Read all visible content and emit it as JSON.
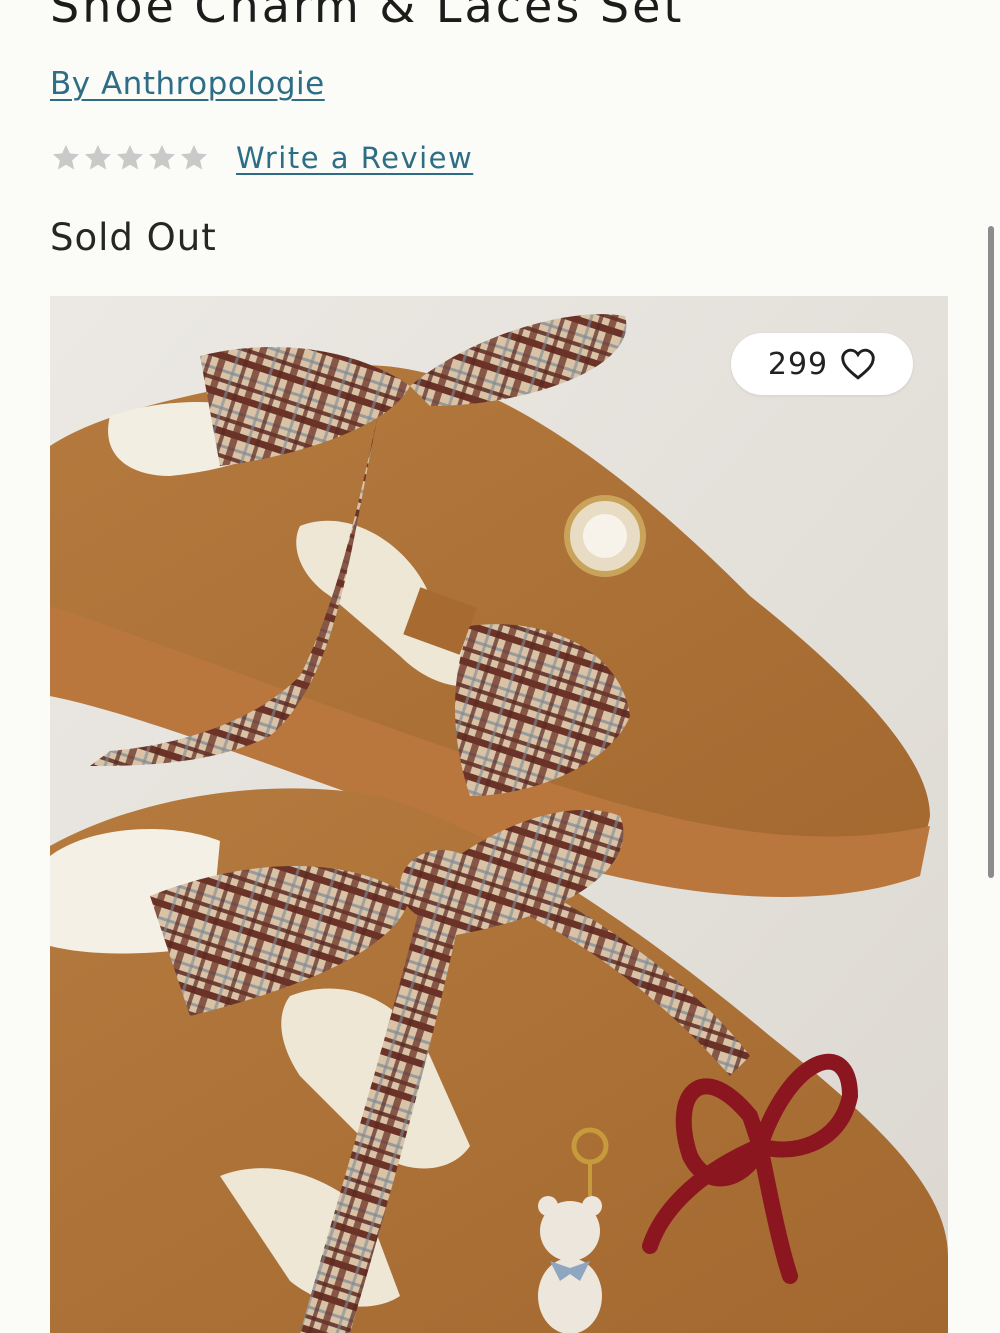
{
  "product": {
    "title": "Shoe Charm & Laces Set",
    "brand_label": "By Anthropologie",
    "rating": 0,
    "max_rating": 5,
    "write_review_label": "Write a Review",
    "availability": "Sold Out"
  },
  "gallery": {
    "likes_count": "299",
    "heart_icon": "heart-outline-icon"
  },
  "colors": {
    "link": "#2d6e86",
    "star_empty": "#c9c9c9",
    "background": "#fbfbf7"
  }
}
